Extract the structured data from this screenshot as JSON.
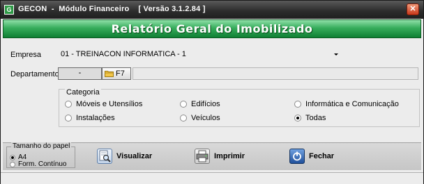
{
  "window": {
    "icon_letter": "G",
    "title": "GECON  -  Módulo Financeiro    [ Versão 3.1.2.84 ]",
    "close_symbol": "✕"
  },
  "banner": {
    "title": "Relatório Geral do Imobilizado"
  },
  "empresa": {
    "label": "Empresa",
    "value": "01 - TREINACON INFORMATICA - 1"
  },
  "departamento": {
    "label": "Departamento",
    "code": "-",
    "button_label": "F7",
    "name": ""
  },
  "categoria": {
    "legend": "Categoria",
    "options": [
      {
        "label": "Móveis e Utensílios",
        "checked": false
      },
      {
        "label": "Edifícios",
        "checked": false
      },
      {
        "label": "Informática e Comunicação",
        "checked": false
      },
      {
        "label": "Instalações",
        "checked": false
      },
      {
        "label": "Veículos",
        "checked": false
      },
      {
        "label": "Todas",
        "checked": true
      }
    ]
  },
  "tamanho_papel": {
    "legend": "Tamanho do papel",
    "options": [
      {
        "label": "A4",
        "checked": true
      },
      {
        "label": "Form. Contínuo",
        "checked": false
      }
    ]
  },
  "actions": {
    "visualizar": {
      "label": "Visualizar",
      "icon": "preview-icon"
    },
    "imprimir": {
      "label": "Imprimir",
      "icon": "printer-icon"
    },
    "fechar": {
      "label": "Fechar",
      "icon": "power-icon"
    }
  },
  "colors": {
    "banner_green": "#1f9445",
    "title_bar": "#2e2e2e",
    "close_red": "#c8381a"
  }
}
